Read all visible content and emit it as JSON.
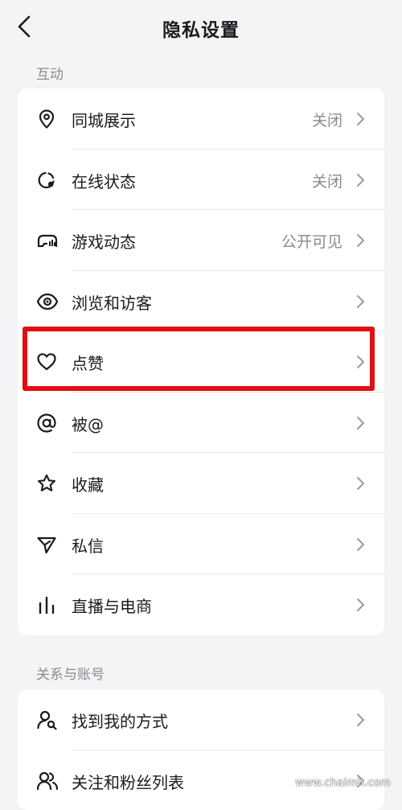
{
  "header": {
    "title": "隐私设置"
  },
  "sections": [
    {
      "title": "互动",
      "items": [
        {
          "icon": "location-pin-icon",
          "label": "同城展示",
          "value": "关闭"
        },
        {
          "icon": "online-status-icon",
          "label": "在线状态",
          "value": "关闭"
        },
        {
          "icon": "gamepad-icon",
          "label": "游戏动态",
          "value": "公开可见"
        },
        {
          "icon": "eye-icon",
          "label": "浏览和访客",
          "value": ""
        },
        {
          "icon": "heart-icon",
          "label": "点赞",
          "value": ""
        },
        {
          "icon": "at-icon",
          "label": "被@",
          "value": ""
        },
        {
          "icon": "star-icon",
          "label": "收藏",
          "value": ""
        },
        {
          "icon": "send-icon",
          "label": "私信",
          "value": ""
        },
        {
          "icon": "live-bars-icon",
          "label": "直播与电商",
          "value": ""
        }
      ]
    },
    {
      "title": "关系与账号",
      "items": [
        {
          "icon": "find-user-icon",
          "label": "找到我的方式",
          "value": ""
        },
        {
          "icon": "followers-icon",
          "label": "关注和粉丝列表",
          "value": ""
        }
      ]
    }
  ],
  "highlight_color": "#e10f12",
  "watermark": "www.chaimh.com"
}
